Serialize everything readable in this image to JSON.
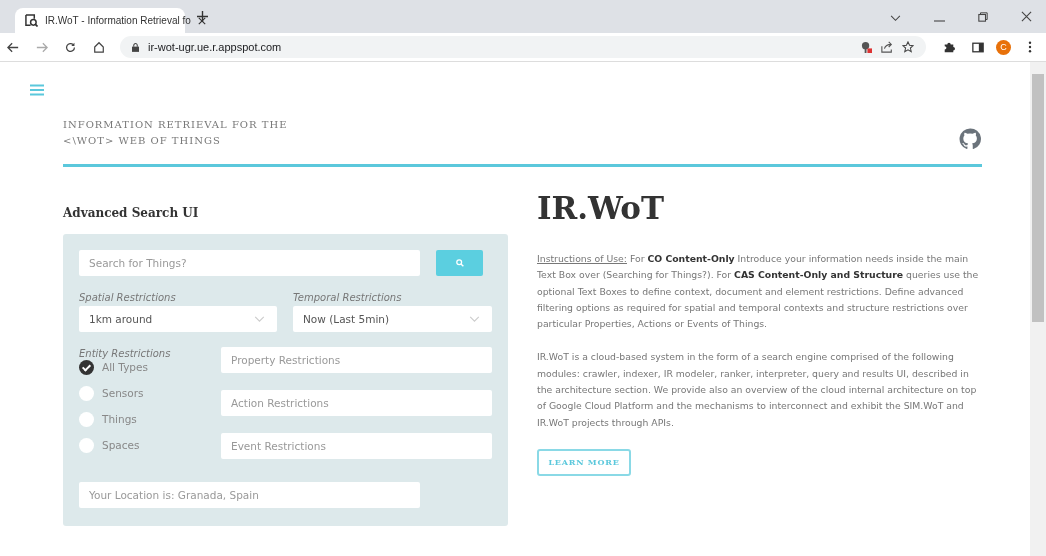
{
  "browser": {
    "tab_title": "IR.WoT - Information Retrieval fo",
    "url": "ir-wot-ugr.ue.r.appspot.com",
    "profile_initial": "C"
  },
  "header": {
    "title_lines": [
      "INFORMATION RETRIEVAL FOR THE",
      "<\\WOT> WEB OF THINGS"
    ]
  },
  "search_panel": {
    "heading": "Advanced Search UI",
    "search": {
      "placeholder": "Search for Things?"
    },
    "spatial": {
      "label": "Spatial Restrictions",
      "value": "1km around"
    },
    "temporal": {
      "label": "Temporal Restrictions",
      "value": "Now (Last 5min)"
    },
    "entity_label": "Entity Restrictions",
    "entities": [
      {
        "label": "All Types",
        "selected": true
      },
      {
        "label": "Sensors",
        "selected": false
      },
      {
        "label": "Things",
        "selected": false
      },
      {
        "label": "Spaces",
        "selected": false
      }
    ],
    "restriction_fields": [
      {
        "placeholder": "Property Restrictions"
      },
      {
        "placeholder": "Action Restrictions"
      },
      {
        "placeholder": "Event Restrictions"
      }
    ],
    "location": {
      "placeholder": "Your Location is: Granada, Spain"
    }
  },
  "intro": {
    "title": "IR.WoT",
    "instructions_link": "Instructions of Use:",
    "instructions_text": " For **CO Content-Only** Introduce your information needs inside the main Text Box over (Searching for Things?). For **CAS Content-Only and Structure** queries use the optional Text Boxes to define context, document and element restrictions. Define advanced filtering options as required for spatial and temporal contexts and structure restrictions over particular Properties, Actions or Events of Things.",
    "description": "IR.WoT is a cloud-based system in the form of a search engine comprised of the following modules: crawler, indexer, IR modeler, ranker, interpreter, query and results UI, described in the architecture section. We provide also an overview of the cloud internal architecture on top of Google Cloud Platform and the mechanisms to interconnect and exhibit the SIM.WoT and IR.WoT projects through APIs.",
    "button": "LEARN MORE"
  }
}
